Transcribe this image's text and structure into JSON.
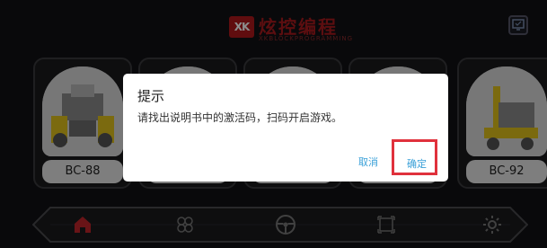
{
  "header": {
    "logo_mark": "XK",
    "title": "炫控编程",
    "subtitle": "XKBLOCKPROGRAMMING"
  },
  "cards": [
    {
      "label": "BC-88"
    },
    {
      "label": ""
    },
    {
      "label": ""
    },
    {
      "label": ""
    },
    {
      "label": "BC-92"
    }
  ],
  "bottom_nav": {
    "items": [
      "home-icon",
      "grid-icon",
      "steering-wheel-icon",
      "fullscreen-icon",
      "settings-gear-icon"
    ]
  },
  "dialog": {
    "title": "提示",
    "message": "请找出说明书中的激活码，扫码开启游戏。",
    "cancel_label": "取消",
    "confirm_label": "确定"
  },
  "colors": {
    "brand_red": "#a81a1e",
    "link_blue": "#3aa0d8",
    "highlight_red": "#e0313c",
    "home_icon_red": "#c0262b"
  }
}
